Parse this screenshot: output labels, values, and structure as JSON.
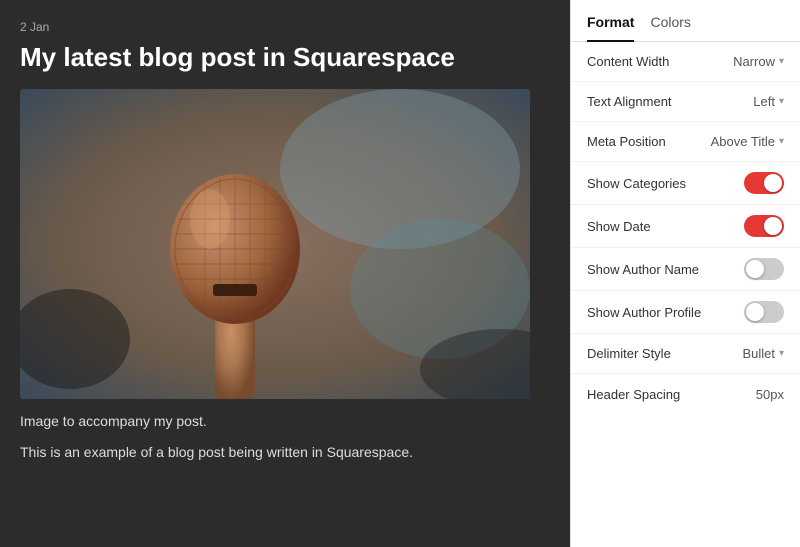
{
  "content": {
    "date": "2 Jan",
    "title": "My latest blog post in Squarespace",
    "image_alt": "Microphone close-up photo",
    "caption": "Image to accompany my post.",
    "body": "This is an example of a blog post being written in Squarespace."
  },
  "panel": {
    "tabs": [
      {
        "id": "format",
        "label": "Format",
        "active": true
      },
      {
        "id": "colors",
        "label": "Colors",
        "active": false
      }
    ],
    "settings": [
      {
        "id": "content-width",
        "label": "Content Width",
        "type": "dropdown",
        "value": "Narrow"
      },
      {
        "id": "text-alignment",
        "label": "Text Alignment",
        "type": "dropdown",
        "value": "Left"
      },
      {
        "id": "meta-position",
        "label": "Meta Position",
        "type": "dropdown",
        "value": "Above Title"
      },
      {
        "id": "show-categories",
        "label": "Show Categories",
        "type": "toggle",
        "value": true
      },
      {
        "id": "show-date",
        "label": "Show Date",
        "type": "toggle",
        "value": true
      },
      {
        "id": "show-author-name",
        "label": "Show Author Name",
        "type": "toggle",
        "value": false
      },
      {
        "id": "show-author-profile",
        "label": "Show Author Profile",
        "type": "toggle",
        "value": false
      },
      {
        "id": "delimiter-style",
        "label": "Delimiter Style",
        "type": "dropdown",
        "value": "Bullet"
      },
      {
        "id": "header-spacing",
        "label": "Header Spacing",
        "type": "text",
        "value": "50px"
      }
    ]
  }
}
